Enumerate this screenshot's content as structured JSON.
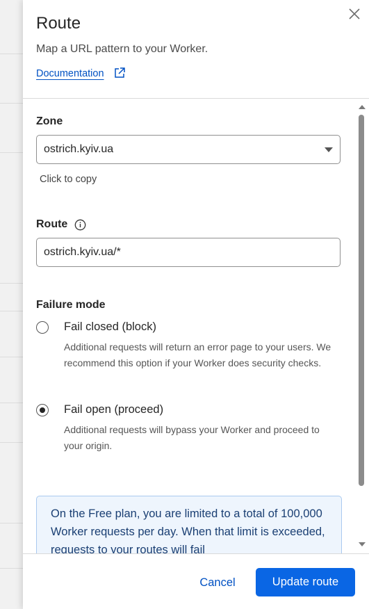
{
  "header": {
    "title": "Route",
    "subtitle": "Map a URL pattern to your Worker.",
    "doc_link": "Documentation"
  },
  "zone": {
    "label": "Zone",
    "value": "ostrich.kyiv.ua",
    "hint": "Click to copy"
  },
  "route": {
    "label": "Route",
    "value": "ostrich.kyiv.ua/*"
  },
  "failure": {
    "label": "Failure mode",
    "options": [
      {
        "label": "Fail closed (block)",
        "selected": false,
        "description": "Additional requests will return an error page to your users. We recommend this option if your Worker does security checks."
      },
      {
        "label": "Fail open (proceed)",
        "selected": true,
        "description": "Additional requests will bypass your Worker and proceed to your origin."
      }
    ]
  },
  "notice": {
    "text": "On the Free plan, you are limited to a total of 100,000 Worker requests per day. When that limit is exceeded, requests to your routes will fail"
  },
  "footer": {
    "cancel_label": "Cancel",
    "update_label": "Update route"
  },
  "colors": {
    "primary": "#0a66e4",
    "link": "#0051c3",
    "notice_bg": "#eef5fd",
    "notice_border": "#a9c9ef"
  }
}
